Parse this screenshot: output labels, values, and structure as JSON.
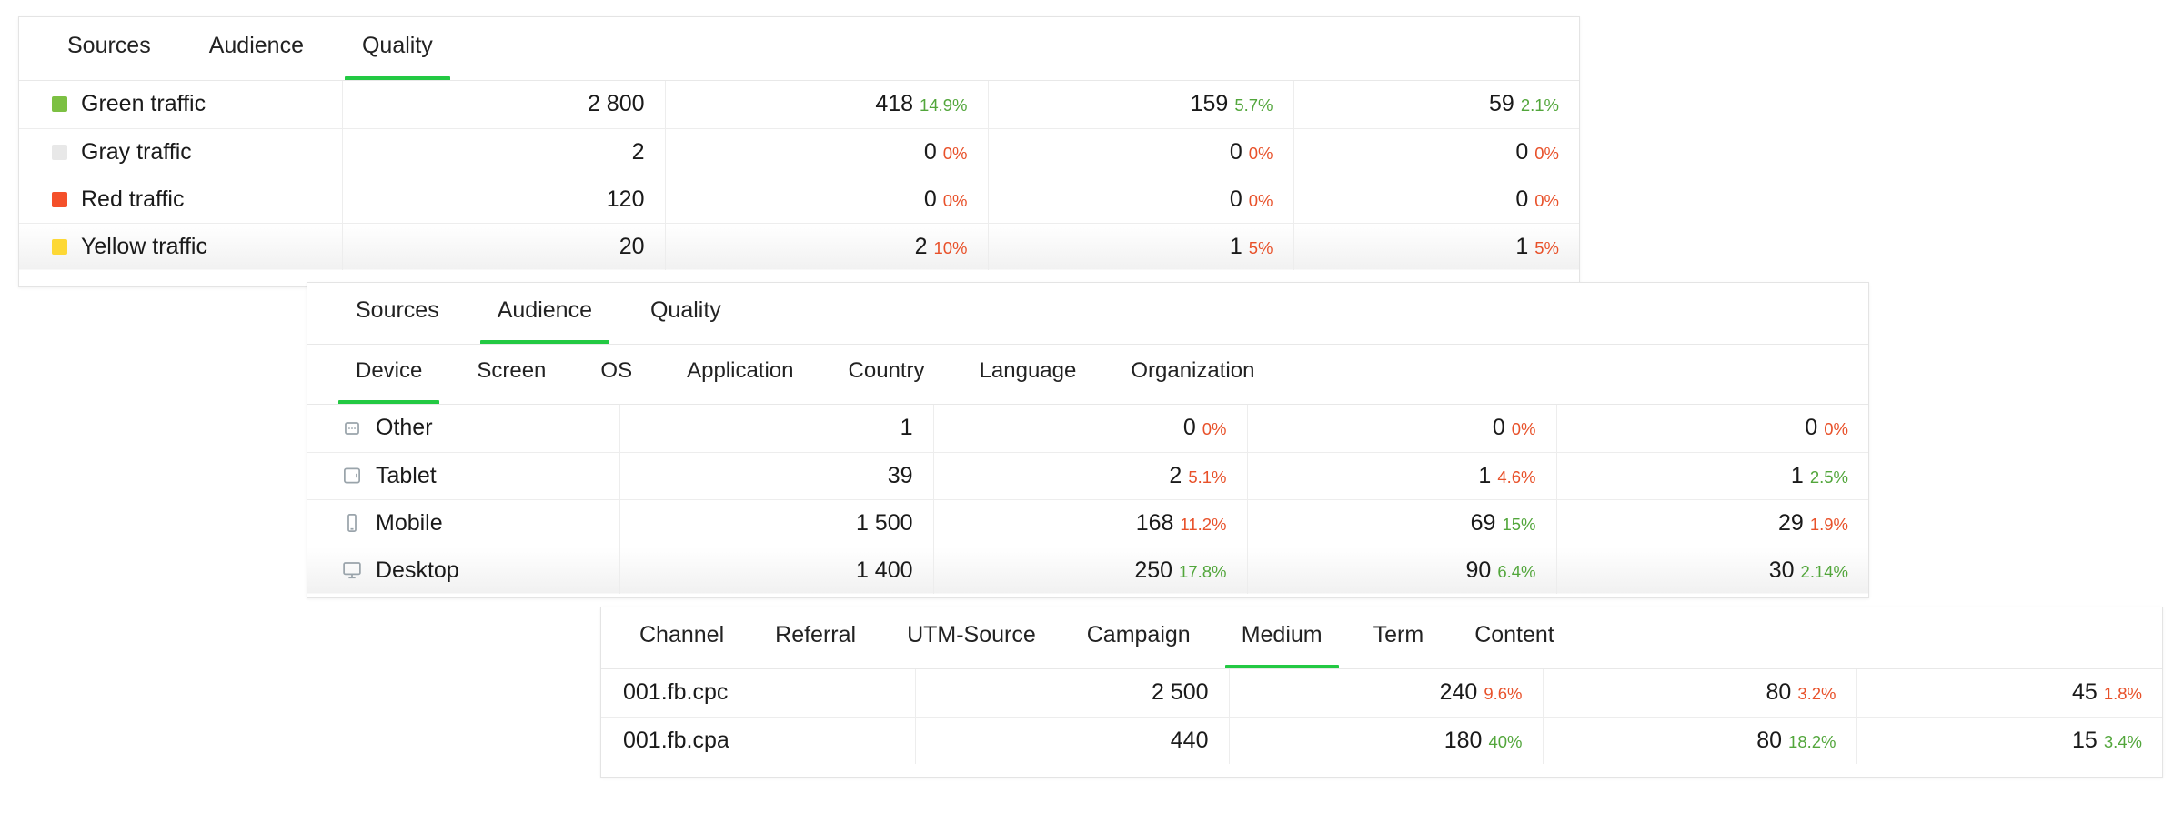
{
  "colors": {
    "accent_green": "#23c943",
    "pct_up": "#52a63b",
    "pct_down": "#e8512a",
    "swatch_green": "#7cc043",
    "swatch_gray": "#e8e8e8",
    "swatch_red": "#f4502a",
    "swatch_yellow": "#fdd835",
    "panel_border": "#e4e4e4",
    "grid_line": "#ededed",
    "text": "#1a1a1a"
  },
  "panels": {
    "quality": {
      "tabs": [
        {
          "label": "Sources",
          "active": false
        },
        {
          "label": "Audience",
          "active": false
        },
        {
          "label": "Quality",
          "active": true
        }
      ],
      "rows": [
        {
          "swatch": "swatch-green",
          "label": "Green traffic",
          "hovered": false,
          "cells": [
            {
              "value": "2 800",
              "pct": "",
              "dir": ""
            },
            {
              "value": "418",
              "pct": "14.9%",
              "dir": "up"
            },
            {
              "value": "159",
              "pct": "5.7%",
              "dir": "up"
            },
            {
              "value": "59",
              "pct": "2.1%",
              "dir": "up"
            }
          ]
        },
        {
          "swatch": "swatch-gray",
          "label": "Gray traffic",
          "hovered": false,
          "cells": [
            {
              "value": "2",
              "pct": "",
              "dir": ""
            },
            {
              "value": "0",
              "pct": "0%",
              "dir": "down"
            },
            {
              "value": "0",
              "pct": "0%",
              "dir": "down"
            },
            {
              "value": "0",
              "pct": "0%",
              "dir": "down"
            }
          ]
        },
        {
          "swatch": "swatch-red",
          "label": "Red traffic",
          "hovered": false,
          "cells": [
            {
              "value": "120",
              "pct": "",
              "dir": ""
            },
            {
              "value": "0",
              "pct": "0%",
              "dir": "down"
            },
            {
              "value": "0",
              "pct": "0%",
              "dir": "down"
            },
            {
              "value": "0",
              "pct": "0%",
              "dir": "down"
            }
          ]
        },
        {
          "swatch": "swatch-yellow",
          "label": "Yellow traffic",
          "hovered": true,
          "cells": [
            {
              "value": "20",
              "pct": "",
              "dir": ""
            },
            {
              "value": "2",
              "pct": "10%",
              "dir": "down"
            },
            {
              "value": "1",
              "pct": "5%",
              "dir": "down"
            },
            {
              "value": "1",
              "pct": "5%",
              "dir": "down"
            }
          ]
        }
      ]
    },
    "audience": {
      "tabs": [
        {
          "label": "Sources",
          "active": false
        },
        {
          "label": "Audience",
          "active": true
        },
        {
          "label": "Quality",
          "active": false
        }
      ],
      "subtabs": [
        {
          "label": "Device",
          "active": true
        },
        {
          "label": "Screen",
          "active": false
        },
        {
          "label": "OS",
          "active": false
        },
        {
          "label": "Application",
          "active": false
        },
        {
          "label": "Country",
          "active": false
        },
        {
          "label": "Language",
          "active": false
        },
        {
          "label": "Organization",
          "active": false
        }
      ],
      "rows": [
        {
          "icon": "other-device-icon",
          "label": "Other",
          "hovered": false,
          "cells": [
            {
              "value": "1",
              "pct": "",
              "dir": ""
            },
            {
              "value": "0",
              "pct": "0%",
              "dir": "down"
            },
            {
              "value": "0",
              "pct": "0%",
              "dir": "down"
            },
            {
              "value": "0",
              "pct": "0%",
              "dir": "down"
            }
          ]
        },
        {
          "icon": "tablet-icon",
          "label": "Tablet",
          "hovered": false,
          "cells": [
            {
              "value": "39",
              "pct": "",
              "dir": ""
            },
            {
              "value": "2",
              "pct": "5.1%",
              "dir": "down"
            },
            {
              "value": "1",
              "pct": "4.6%",
              "dir": "down"
            },
            {
              "value": "1",
              "pct": "2.5%",
              "dir": "up"
            }
          ]
        },
        {
          "icon": "mobile-icon",
          "label": "Mobile",
          "hovered": false,
          "cells": [
            {
              "value": "1 500",
              "pct": "",
              "dir": ""
            },
            {
              "value": "168",
              "pct": "11.2%",
              "dir": "down"
            },
            {
              "value": "69",
              "pct": "15%",
              "dir": "up"
            },
            {
              "value": "29",
              "pct": "1.9%",
              "dir": "down"
            }
          ]
        },
        {
          "icon": "desktop-icon",
          "label": "Desktop",
          "hovered": true,
          "cells": [
            {
              "value": "1 400",
              "pct": "",
              "dir": ""
            },
            {
              "value": "250",
              "pct": "17.8%",
              "dir": "up"
            },
            {
              "value": "90",
              "pct": "6.4%",
              "dir": "up"
            },
            {
              "value": "30",
              "pct": "2.14%",
              "dir": "up"
            }
          ]
        }
      ]
    },
    "medium": {
      "tabs": [
        {
          "label": "Channel",
          "active": false
        },
        {
          "label": "Referral",
          "active": false
        },
        {
          "label": "UTM-Source",
          "active": false
        },
        {
          "label": "Campaign",
          "active": false
        },
        {
          "label": "Medium",
          "active": true
        },
        {
          "label": "Term",
          "active": false
        },
        {
          "label": "Content",
          "active": false
        }
      ],
      "rows": [
        {
          "label": "001.fb.cpc",
          "hovered": false,
          "cells": [
            {
              "value": "2 500",
              "pct": "",
              "dir": ""
            },
            {
              "value": "240",
              "pct": "9.6%",
              "dir": "down"
            },
            {
              "value": "80",
              "pct": "3.2%",
              "dir": "down"
            },
            {
              "value": "45",
              "pct": "1.8%",
              "dir": "down"
            }
          ]
        },
        {
          "label": "001.fb.cpa",
          "hovered": false,
          "cells": [
            {
              "value": "440",
              "pct": "",
              "dir": ""
            },
            {
              "value": "180",
              "pct": "40%",
              "dir": "up"
            },
            {
              "value": "80",
              "pct": "18.2%",
              "dir": "up"
            },
            {
              "value": "15",
              "pct": "3.4%",
              "dir": "up"
            }
          ]
        }
      ]
    }
  }
}
